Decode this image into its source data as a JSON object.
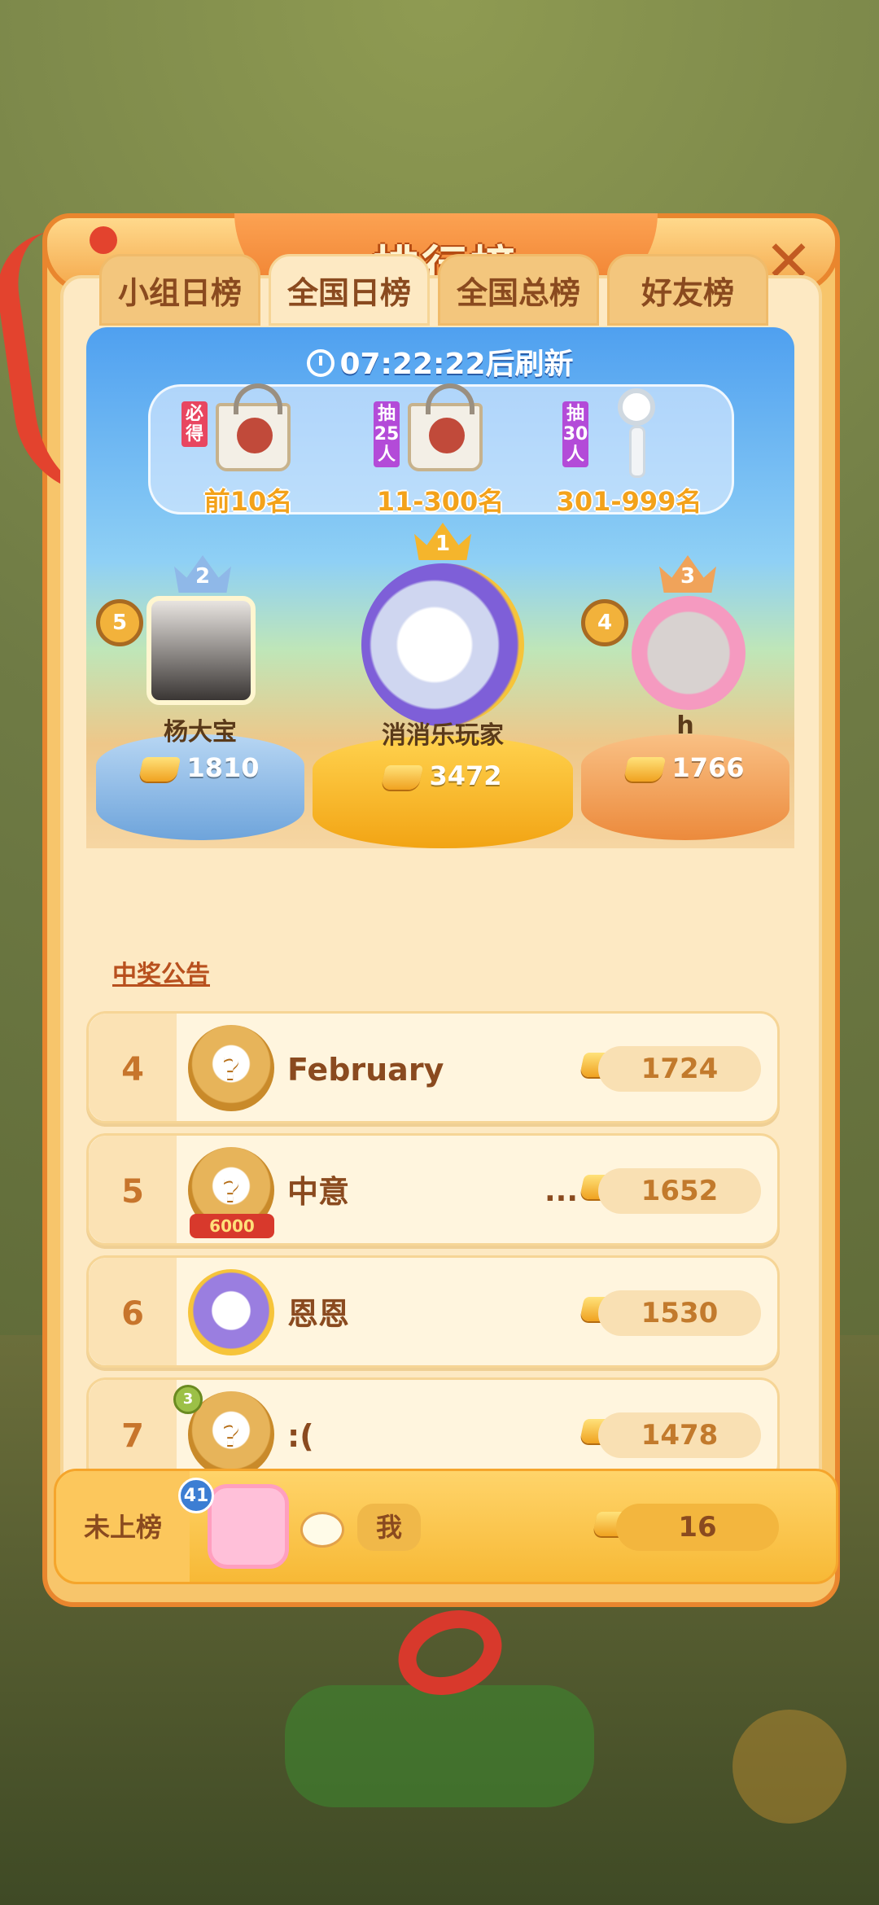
{
  "header": {
    "title": "排行榜",
    "close_label": "✕"
  },
  "tabs": [
    {
      "label": "小组日榜",
      "active": false
    },
    {
      "label": "全国日榜",
      "active": true
    },
    {
      "label": "全国总榜",
      "active": false
    },
    {
      "label": "好友榜",
      "active": false
    }
  ],
  "refresh": {
    "countdown": "07:22:22",
    "suffix": "后刷新"
  },
  "rewards": [
    {
      "tag": "必得",
      "label": "前10名",
      "item": "bag-icon"
    },
    {
      "tag": "抽25人",
      "label": "11-300名",
      "item": "bag-icon"
    },
    {
      "tag": "抽30人",
      "label": "301-999名",
      "item": "fan-icon"
    }
  ],
  "podium": {
    "first": {
      "crown": "1",
      "name": "消消乐玩家",
      "score": "3472"
    },
    "second": {
      "crown": "2",
      "level": "5",
      "name": "杨大宝",
      "score": "1810"
    },
    "third": {
      "crown": "3",
      "level": "4",
      "name": "h",
      "score": "1766"
    }
  },
  "notice_link": "中奖公告",
  "list": [
    {
      "rank": "4",
      "name": "February",
      "score": "1724",
      "extra": "",
      "badge": ""
    },
    {
      "rank": "5",
      "name": "中意",
      "score": "1652",
      "extra": "...",
      "badge": "6000"
    },
    {
      "rank": "6",
      "name": "恩恩",
      "score": "1530",
      "extra": "",
      "badge": ""
    },
    {
      "rank": "7",
      "name": ":(",
      "score": "1478",
      "extra": "",
      "badge": "3"
    }
  ],
  "me": {
    "rank_label": "未上榜",
    "level": "41",
    "name": "我",
    "score": "16"
  },
  "colors": {
    "accent": "#e9862e",
    "panel": "#fde9c3",
    "gold": "#f0a220"
  }
}
